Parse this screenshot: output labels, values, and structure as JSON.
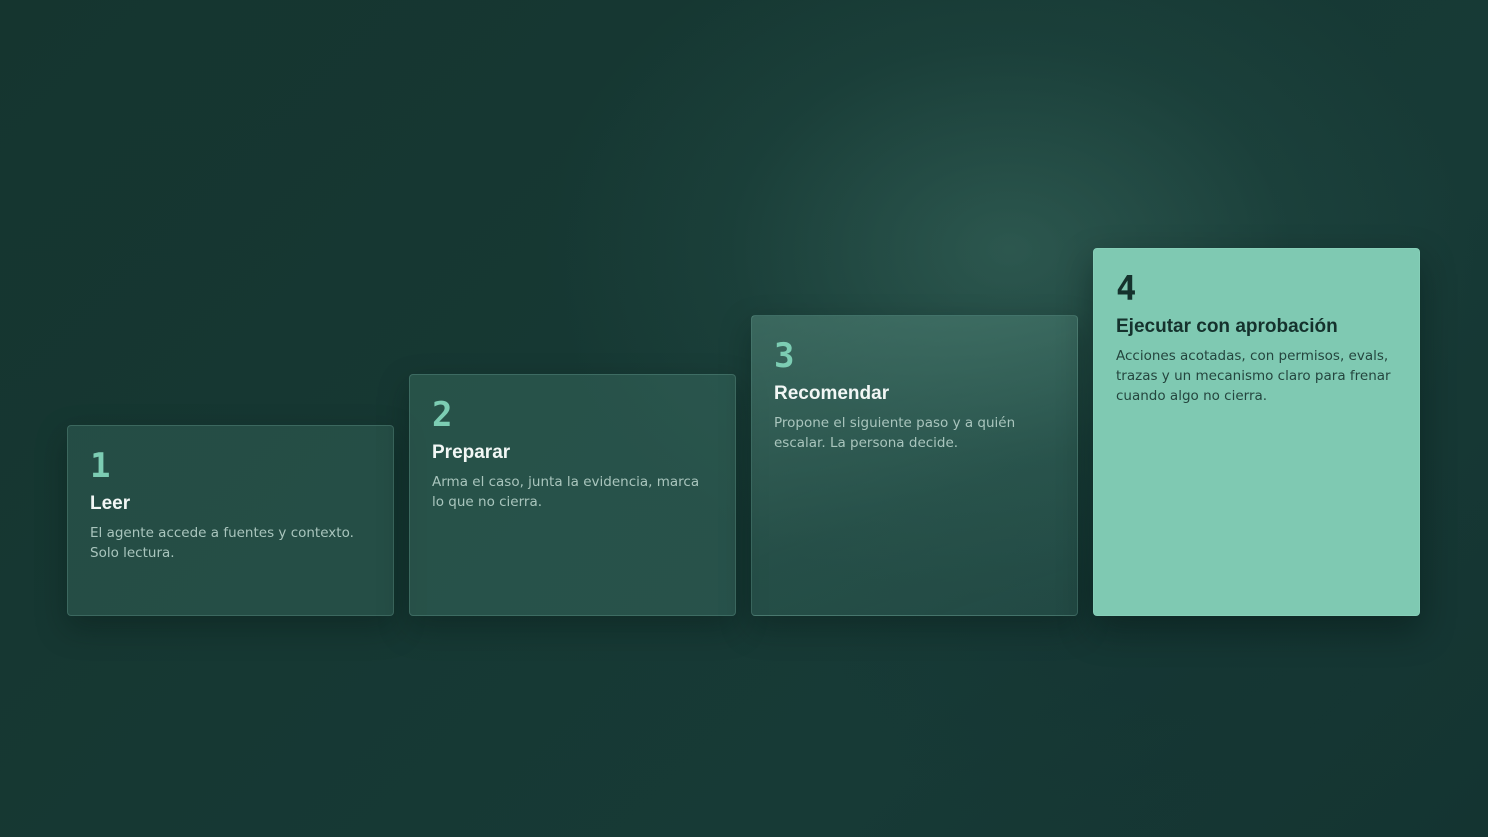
{
  "steps": [
    {
      "number": "1",
      "title": "Leer",
      "description": "El agente accede a fuentes y contexto. Solo lectura."
    },
    {
      "number": "2",
      "title": "Preparar",
      "description": "Arma el caso, junta la evidencia, marca lo que no cierra."
    },
    {
      "number": "3",
      "title": "Recomendar",
      "description": "Propone el siguiente paso y a quién escalar. La persona decide."
    },
    {
      "number": "4",
      "title": "Ejecutar con aprobación",
      "description": "Acciones acotadas, con permisos, evals, trazas y un mecanismo claro para frenar cuando algo no cierra."
    }
  ],
  "colors": {
    "background": "#163833",
    "accent": "#7fc9b2",
    "text_light": "#f2f7f5",
    "text_muted": "#a9c5bd",
    "text_dark": "#15322d"
  }
}
